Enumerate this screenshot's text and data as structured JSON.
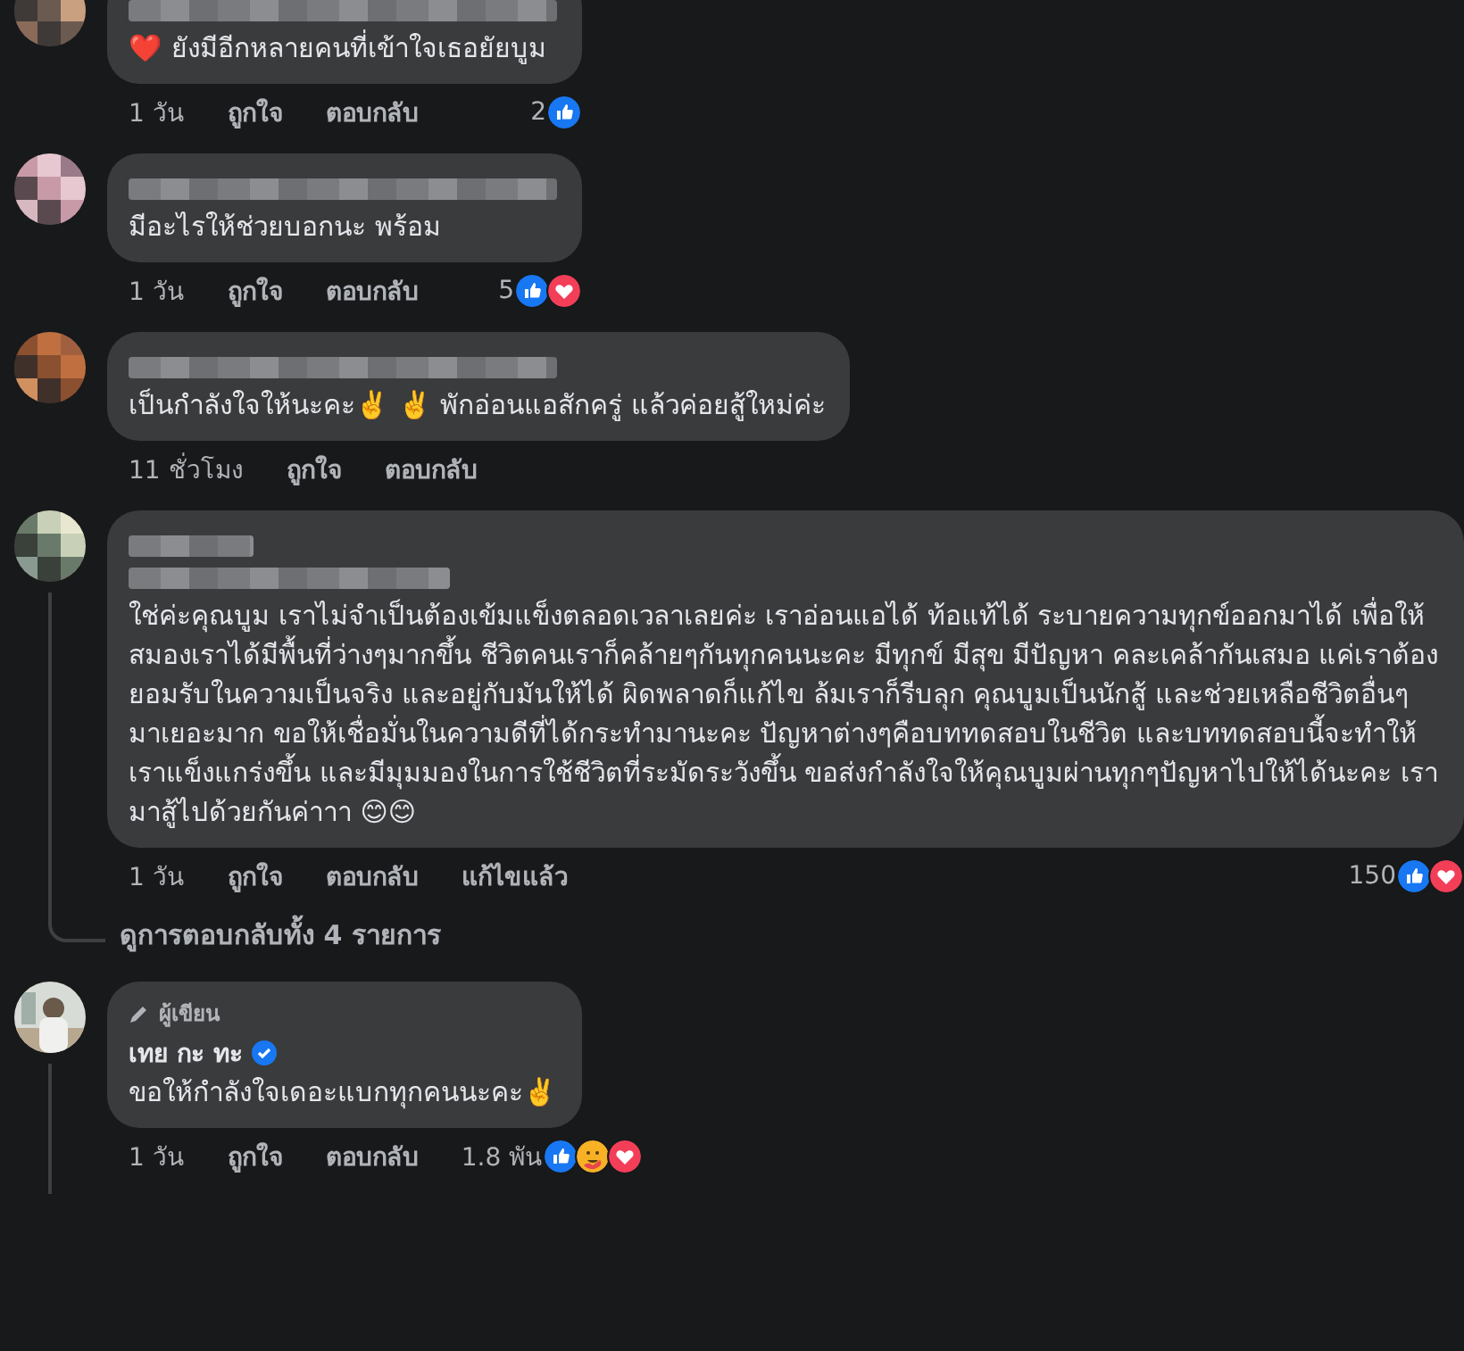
{
  "comments": [
    {
      "redacted_badge": false,
      "text": "❤️ ยังมีอีกหลายคนที่เข้าใจเธอยัยบูม",
      "meta": {
        "time": "1 วัน",
        "like": "ถูกใจ",
        "reply": "ตอบกลับ"
      },
      "reactions": {
        "count": "2",
        "icons": [
          {
            "kind": "like"
          }
        ]
      }
    },
    {
      "redacted_badge": false,
      "text": "มีอะไรให้ช่วยบอกนะ พร้อม",
      "meta": {
        "time": "1 วัน",
        "like": "ถูกใจ",
        "reply": "ตอบกลับ"
      },
      "reactions": {
        "count": "5",
        "icons": [
          {
            "kind": "like"
          },
          {
            "kind": "love"
          }
        ]
      }
    },
    {
      "redacted_badge": false,
      "text": "เป็นกำลังใจให้นะคะ✌️ ✌️ พักอ่อนแอสักครู่ แล้วค่อยสู้ใหม่ค่ะ",
      "meta": {
        "time": "11 ชั่วโมง",
        "like": "ถูกใจ",
        "reply": "ตอบกลับ"
      }
    },
    {
      "redacted_badge": true,
      "text": "ใช่ค่ะคุณบูม เราไม่จำเป็นต้องเข้มแข็งตลอดเวลาเลยค่ะ เราอ่อนแอได้ ท้อแท้ได้ ระบายความทุกข์ออกมาได้ เพื่อให้สมองเราได้มีพื้นที่ว่างๆมากขึ้น ชีวิตคนเราก็คล้ายๆกันทุกคนนะคะ มีทุกข์ มีสุข มีปัญหา คละเคล้ากันเสมอ แค่เราต้องยอมรับในความเป็นจริง และอยู่กับมันให้ได้ ผิดพลาดก็แก้ไข ล้มเราก็รีบลุก คุณบูมเป็นนักสู้ และช่วยเหลือชีวิตอื่นๆมาเยอะมาก ขอให้เชื่อมั่นในความดีที่ได้กระทำมานะคะ ปัญหาต่างๆคือบททดสอบในชีวิต และบททดสอบนี้จะทำให้เราแข็งแกร่งขึ้น และมีมุมมองในการใช้ชีวิตที่ระมัดระวังขึ้น ขอส่งกำลังใจให้คุณบูมผ่านทุกๆปัญหาไปให้ได้นะคะ เรามาสู้ไปด้วยกันค่าาา 😊😊",
      "meta": {
        "time": "1 วัน",
        "like": "ถูกใจ",
        "reply": "ตอบกลับ",
        "edited": "แก้ไขแล้ว"
      },
      "reactions": {
        "count": "150",
        "icons": [
          {
            "kind": "like"
          },
          {
            "kind": "love"
          }
        ]
      },
      "view_replies": "ดูการตอบกลับทั้ง 4 รายการ"
    },
    {
      "badge": "ผู้เขียน",
      "name": "เทย กะ ทะ",
      "verified": true,
      "text": "ขอให้กำลังใจเดอะแบกทุกคนนะคะ✌️",
      "meta": {
        "time": "1 วัน",
        "like": "ถูกใจ",
        "reply": "ตอบกลับ"
      },
      "reactions": {
        "count": "1.8 พัน",
        "icons": [
          {
            "kind": "like"
          },
          {
            "kind": "care"
          },
          {
            "kind": "love"
          }
        ]
      }
    }
  ]
}
